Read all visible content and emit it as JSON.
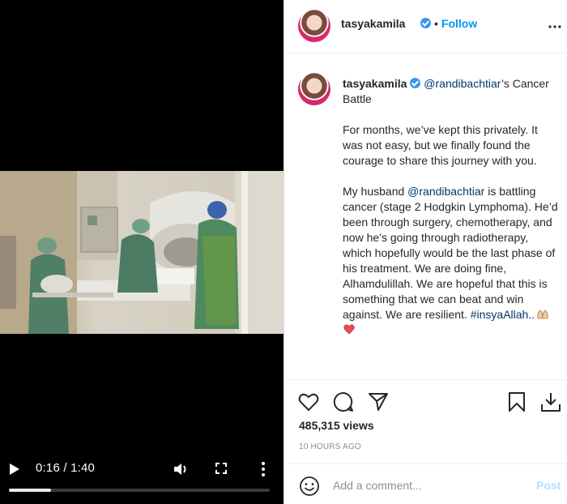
{
  "video": {
    "current_time": "0:16",
    "separator": " / ",
    "duration": "1:40",
    "progress": 0.16
  },
  "post": {
    "author": "tasyakamila",
    "follow_label": "Follow",
    "dot": "•",
    "caption": {
      "mention_title": "@randibachtiar",
      "title_suffix": "’s Cancer Battle",
      "para1": "For months, we’ve kept this privately. It was not easy, but we finally found the courage to share this journey with you.",
      "para2_prefix": "My husband ",
      "para2_mention": "@randibachtiar",
      "para2_body": " is battling cancer (stage 2 Hodgkin Lymphoma). He’d been through surgery, chemotherapy, and now he’s going through radiotherapy, which hopefully would be the last phase of his treatment. We are doing fine, Alhamdulillah. We are hopeful that this is something that we can beat and win against. We are resilient.",
      "hashtag": "#insyaAllah..",
      "emojis": [
        "praying-hands-emoji",
        "red-heart-emoji"
      ]
    },
    "views": "485,315 views",
    "time_ago": "10 HOURS AGO",
    "comment_placeholder": "Add a comment...",
    "post_label": "Post"
  },
  "colors": {
    "link_blue": "#0095f6",
    "mention_blue": "#00376b",
    "post_disabled": "#b2dffc",
    "verified_blue": "#3897f0",
    "heart_red": "#ed4956"
  },
  "icons": [
    "play-icon",
    "volume-icon",
    "fullscreen-icon",
    "more-vertical-icon",
    "more-horizontal-icon",
    "heart-icon",
    "comment-icon",
    "share-icon",
    "bookmark-icon",
    "download-icon",
    "smiley-icon",
    "verified-badge-icon"
  ]
}
